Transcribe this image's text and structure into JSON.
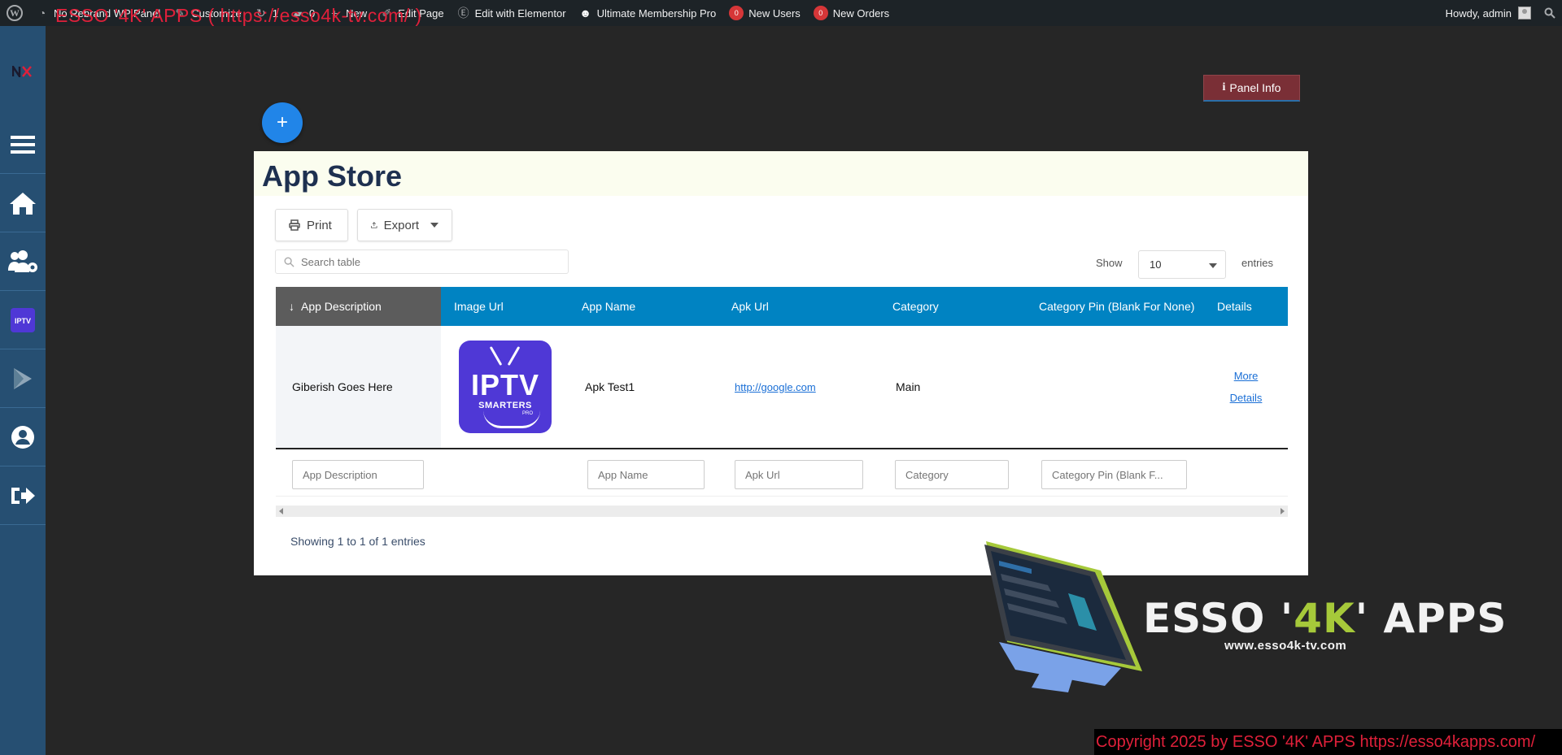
{
  "adminbar": {
    "items": [
      {
        "label": "No Rebrand WP Panel",
        "icon": "gauge-icon"
      },
      {
        "label": "Customize",
        "icon": "paintbrush-icon"
      },
      {
        "label": "1",
        "icon": "refresh-icon"
      },
      {
        "label": "0",
        "icon": "comment-icon"
      },
      {
        "label": "New",
        "icon": "plus-icon"
      },
      {
        "label": "Edit Page",
        "icon": "pencil-icon"
      },
      {
        "label": "Edit with Elementor",
        "icon": "elementor-icon"
      },
      {
        "label": "Ultimate Membership Pro",
        "icon": "membership-icon"
      }
    ],
    "new_users": {
      "count": "0",
      "label": "New Users"
    },
    "new_orders": {
      "count": "0",
      "label": "New Orders"
    },
    "howdy": "Howdy, admin",
    "site_overlay": "ESSO '4K' APPS ( https://esso4k-tv.com/ )"
  },
  "panel_info": {
    "label": "Panel Info",
    "icon_char": "i"
  },
  "fab": {
    "label": "+"
  },
  "page": {
    "title": "App Store",
    "print_label": "Print",
    "export_label": "Export",
    "search_placeholder": "Search table",
    "show_label": "Show",
    "entries_value": "10",
    "entries_label": "entries",
    "showing_text": "Showing 1 to 1 of 1 entries"
  },
  "table": {
    "columns": [
      "App Description",
      "Image Url",
      "App Name",
      "Apk Url",
      "Category",
      "Category Pin (Blank For None)",
      "Details"
    ],
    "sort_arrow": "↓",
    "row": {
      "app_description": "Giberish Goes Here",
      "image_text": "IPTV",
      "image_subtext": "SMARTERS",
      "image_pro": "PRO",
      "app_name": "Apk Test1",
      "apk_url": "http://google.com",
      "category": "Main",
      "category_pin": "",
      "details_line1": "More",
      "details_line2": "Details"
    },
    "filters": {
      "app_description": "App Description",
      "app_name": "App Name",
      "apk_url": "Apk Url",
      "category": "Category",
      "category_pin": "Category Pin (Blank F..."
    }
  },
  "promo": {
    "title_pre": "ESSO '",
    "title_accent": "4K",
    "title_post": "' APPS",
    "url": "www.esso4k-tv.com"
  },
  "copyright": "Copyright 2025  by ESSO '4K' APPS https://esso4kapps.com/",
  "colors": {
    "sidebar": "#264f72",
    "table_header": "#0083c2",
    "panel_info": "#7a2f36",
    "fab": "#2185e8",
    "accent_green": "#a6c93a",
    "overlay_red": "#e0203a"
  }
}
